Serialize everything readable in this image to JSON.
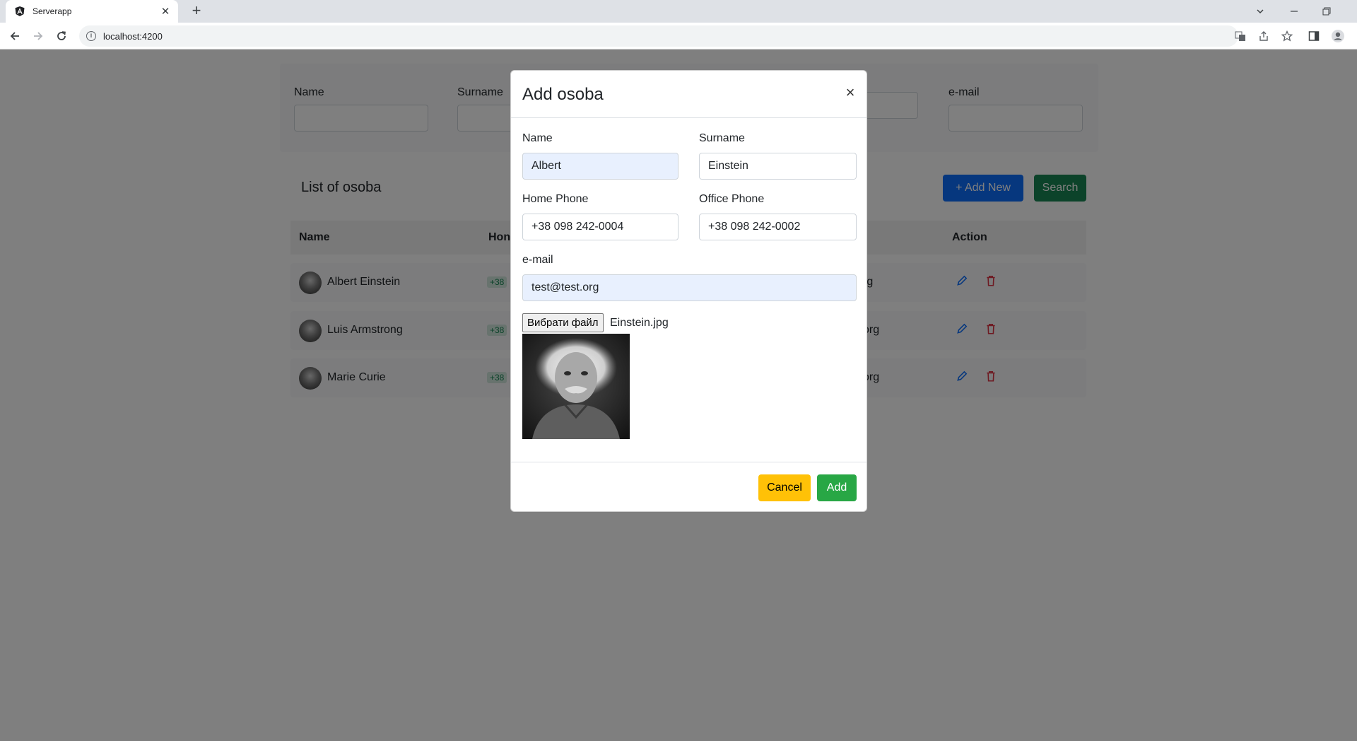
{
  "browser": {
    "tab_title": "Serverapp",
    "url": "localhost:4200"
  },
  "filters": {
    "labels": [
      "Name",
      "Surname",
      "",
      "",
      "e-mail"
    ]
  },
  "list": {
    "title": "List of osoba",
    "add_new_label": "+ Add New",
    "search_label": "Search",
    "columns": {
      "name": "Name",
      "home": "Hon",
      "action": "Action"
    },
    "rows": [
      {
        "name": "Albert Einstein",
        "phone": "+38",
        "email": "rg"
      },
      {
        "name": "Luis Armstrong",
        "phone": "+38",
        "email": "org"
      },
      {
        "name": "Marie Curie",
        "phone": "+38",
        "email": "org"
      }
    ]
  },
  "modal": {
    "title": "Add osoba",
    "close_glyph": "×",
    "name_label": "Name",
    "name_value": "Albert",
    "surname_label": "Surname",
    "surname_value": "Einstein",
    "home_phone_label": "Home Phone",
    "home_phone_value": "+38 098 242-0004",
    "office_phone_label": "Office Phone",
    "office_phone_value": "+38 098 242-0002",
    "email_label": "e-mail",
    "email_value": "test@test.org",
    "file_button_label": "Вибрати файл",
    "file_name": "Einstein.jpg",
    "cancel_label": "Cancel",
    "add_label": "Add"
  },
  "colors": {
    "primary": "#0d6efd",
    "success": "#198754",
    "warning": "#ffc107",
    "danger": "#dc3545"
  }
}
